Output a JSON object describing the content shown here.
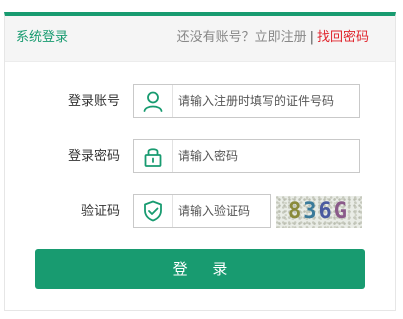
{
  "header": {
    "title": "系统登录",
    "no_account_text": "还没有账号？",
    "register_link": "立即注册",
    "separator": "|",
    "forgot_link": "找回密码"
  },
  "form": {
    "account_label": "登录账号",
    "account_placeholder": "请输入注册时填写的证件号码",
    "password_label": "登录密码",
    "password_placeholder": "请输入密码",
    "captcha_label": "验证码",
    "captcha_placeholder": "请输入验证码",
    "captcha_chars": [
      "8",
      "3",
      "6",
      "G"
    ],
    "submit_label": "登 录"
  },
  "icons": {
    "account": "user-icon",
    "password": "lock-icon",
    "captcha": "shield-check-icon"
  },
  "colors": {
    "primary": "#189b70",
    "link_red": "#e0242c",
    "captcha_char_colors": [
      "#8a8a3a",
      "#3a7a9a",
      "#4a5aa0",
      "#8a5a8a"
    ]
  }
}
